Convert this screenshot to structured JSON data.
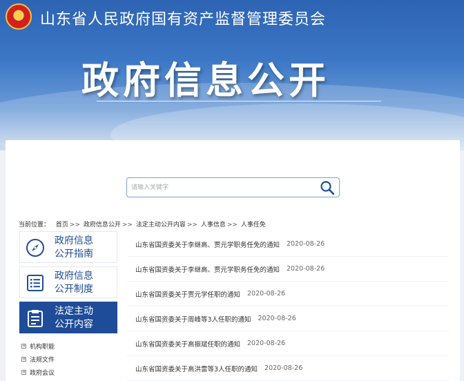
{
  "header": {
    "site_title": "山东省人民政府国有资产监督管理委员会",
    "main_title": "政府信息公开"
  },
  "search": {
    "placeholder": "请输入关键字",
    "button_icon": "search-icon"
  },
  "breadcrumb": {
    "prefix": "当前位置：",
    "items": [
      "首页",
      "政府信息公开",
      "法定主动公开内容",
      "人事信息",
      "人事任免"
    ],
    "separator": ">>"
  },
  "sidebar": {
    "buttons": [
      {
        "label": "政府信息\n公开指南",
        "icon": "compass-icon",
        "active": false
      },
      {
        "label": "政府信息\n公开制度",
        "icon": "document-list-icon",
        "active": false
      },
      {
        "label": "法定主动\n公开内容",
        "icon": "clipboard-icon",
        "active": true
      }
    ],
    "sub_items": [
      "机构职能",
      "法规文件",
      "政府会议"
    ]
  },
  "news": [
    {
      "title": "山东省国资委关于李继高、贾元学职务任免的通知",
      "date": "2020-08-26"
    },
    {
      "title": "山东省国资委关于李继高、贾元学职务任免的通知",
      "date": "2020-08-26"
    },
    {
      "title": "山东省国资委关于贾元学任职的通知",
      "date": "2020-08-26"
    },
    {
      "title": "山东省国资委关于周峰等3人任职的通知",
      "date": "2020-08-26"
    },
    {
      "title": "山东省国资委关于高振斌任职的通知",
      "date": "2020-08-26"
    },
    {
      "title": "山东省国资委关于高洪雷等3人任职的通知",
      "date": "2020-08-26"
    }
  ],
  "colors": {
    "brand_blue": "#1f4c99",
    "banner_blue": "#2d63b3"
  }
}
